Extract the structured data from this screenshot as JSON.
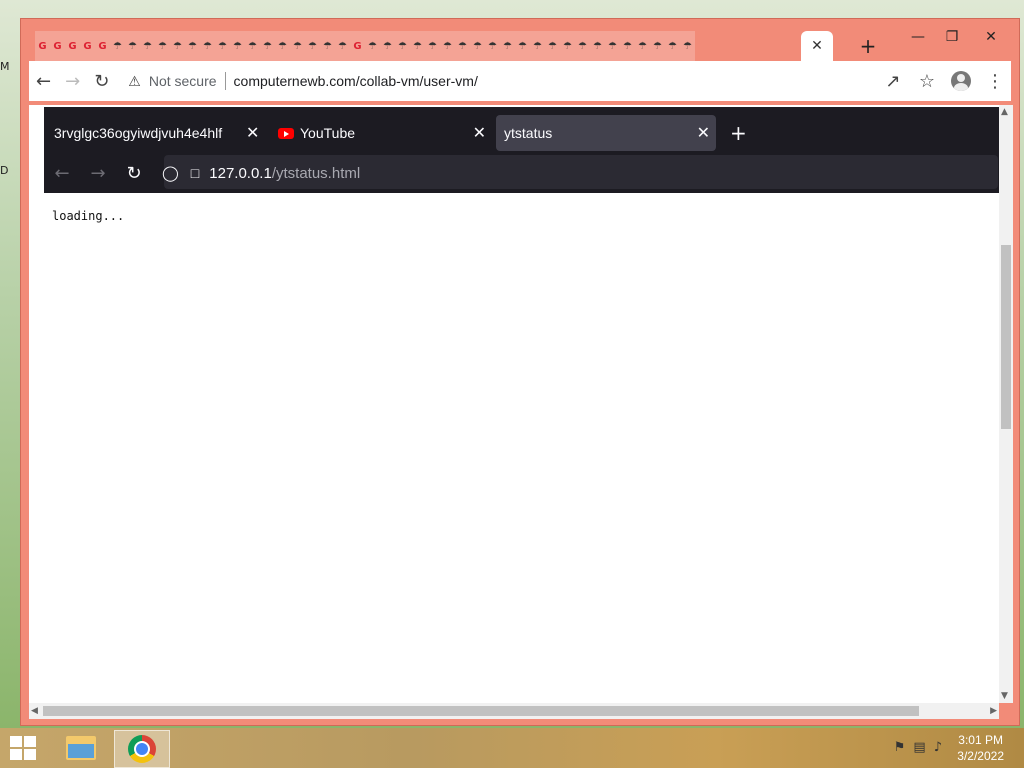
{
  "desktop": {
    "left_labels": [
      "M",
      "D"
    ]
  },
  "chrome": {
    "active_tab_close": "✕",
    "new_tab": "+",
    "mini_tab_count": 44,
    "toolbar": {
      "not_secure": "Not secure",
      "url": "computernewb.com/collab-vm/user-vm/"
    }
  },
  "vm_browser": {
    "tabs": [
      {
        "label": "3rvglgc36ogyiwdjvuh4e4hlf"
      },
      {
        "label": "YouTube"
      },
      {
        "label": "ytstatus"
      }
    ],
    "url_host": "127.0.0.1",
    "url_path": "/ytstatus.html",
    "page_text": "loading..."
  },
  "taskbar": {
    "time": "3:01 PM",
    "date": "3/2/2022"
  }
}
